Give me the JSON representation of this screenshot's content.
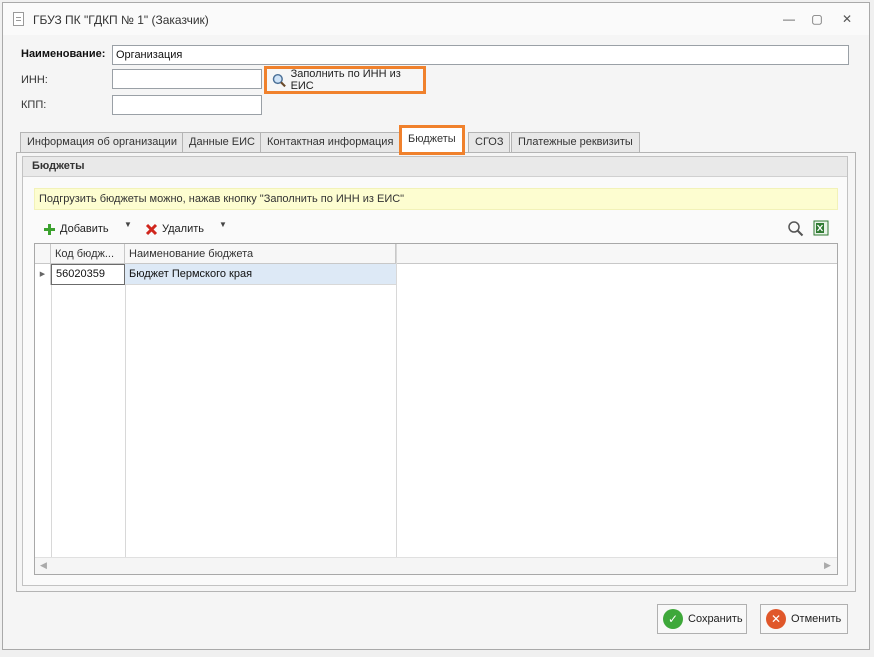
{
  "window": {
    "title": "ГБУЗ ПК \"ГДКП № 1\" (Заказчик)",
    "controls": {
      "minimize": "—",
      "restore": "▢",
      "close": "✕"
    }
  },
  "form": {
    "name_label": "Наименование:",
    "name_value": "Организация",
    "inn_label": "ИНН:",
    "inn_value": "",
    "kpp_label": "КПП:",
    "kpp_value": "",
    "fill_button": "Заполнить по ИНН из ЕИС"
  },
  "tabs": [
    {
      "label": "Информация об организации",
      "active": false
    },
    {
      "label": "Данные ЕИС",
      "active": false
    },
    {
      "label": "Контактная информация",
      "active": false
    },
    {
      "label": "Бюджеты",
      "active": true
    },
    {
      "label": "СГОЗ",
      "active": false
    },
    {
      "label": "Платежные реквизиты",
      "active": false
    }
  ],
  "budgets": {
    "group_title": "Бюджеты",
    "hint": "Подгрузить бюджеты можно, нажав кнопку \"Заполнить по ИНН из ЕИС\"",
    "toolbar": {
      "add": "Добавить",
      "delete": "Удалить"
    },
    "columns": [
      "Код бюдж...",
      "Наименование бюджета"
    ],
    "rows": [
      {
        "code": "56020359",
        "name": "Бюджет Пермского края"
      }
    ]
  },
  "buttons": {
    "save": "Сохранить",
    "cancel": "Отменить"
  },
  "colors": {
    "highlight": "#f0812c",
    "hint_bg": "#fdfdd0",
    "selected_row": "#dde9f6"
  }
}
